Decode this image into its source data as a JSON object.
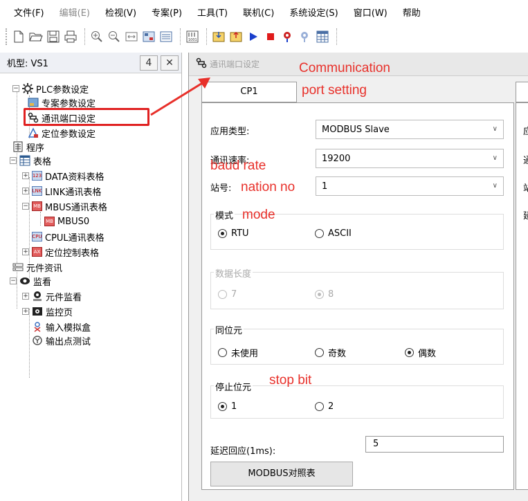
{
  "menu": {
    "items": [
      {
        "label": "文件(F)",
        "disabled": false
      },
      {
        "label": "编辑(E)",
        "disabled": true
      },
      {
        "label": "检视(V)",
        "disabled": false
      },
      {
        "label": "专案(P)",
        "disabled": false
      },
      {
        "label": "工具(T)",
        "disabled": false
      },
      {
        "label": "联机(C)",
        "disabled": false
      },
      {
        "label": "系统设定(S)",
        "disabled": false
      },
      {
        "label": "窗口(W)",
        "disabled": false
      },
      {
        "label": "帮助",
        "disabled": false
      }
    ]
  },
  "toolbar": {
    "icons": [
      "new-file-icon",
      "open-folder-icon",
      "save-icon",
      "print-icon",
      "zoom-in-icon",
      "zoom-out-icon",
      "fit-icon",
      "monitor-icon",
      "list-icon",
      "binary-icon",
      "download-icon",
      "upload-icon",
      "run-icon",
      "stop-icon",
      "monitor-on-icon",
      "monitor-off-icon",
      "table-icon"
    ],
    "colors": {
      "run": "#1a3fcc",
      "stop": "#e01b1b"
    }
  },
  "left_panel": {
    "title": "机型: VS1",
    "pin_label": "4",
    "close_label": "✕",
    "tree": {
      "plc_settings": "PLC参数设定",
      "project_params": "专案参数设定",
      "comm_port": "通讯端口设定",
      "position_params": "定位参数设定",
      "program": "程序",
      "tables": "表格",
      "data_table": "DATA资料表格",
      "link_table": "LINK通讯表格",
      "mbus_table": "MBUS通讯表格",
      "mbus0": "MBUS0",
      "cpul_table": "CPUL通讯表格",
      "position_table": "定位控制表格",
      "component_info": "元件资讯",
      "monitor": "监看",
      "component_monitor": "元件监看",
      "monitor_page": "监控页",
      "input_sim": "输入模拟盒",
      "output_test": "输出点测试"
    }
  },
  "dialog": {
    "title": "通讯端口设定",
    "tab1": "CP1",
    "app_type_label": "应用类型:",
    "app_type_value": "MODBUS Slave",
    "baud_label": "通讯速率:",
    "baud_value": "19200",
    "station_label": "站号:",
    "station_value": "1",
    "mode_group": "模式",
    "mode_rtu": "RTU",
    "mode_ascii": "ASCII",
    "data_length_group": "数据长度",
    "len7": "7",
    "len8": "8",
    "parity_group": "同位元",
    "parity_none": "未使用",
    "parity_odd": "奇数",
    "parity_even": "偶数",
    "stop_group": "停止位元",
    "stop1": "1",
    "stop2": "2",
    "delay_label": "延迟回应(1ms):",
    "delay_value": "5",
    "modbus_button": "MODBUS对照表",
    "pane2_glyphs": [
      "应",
      "通",
      "站",
      "延"
    ]
  },
  "annotations": {
    "comm_line1": "Communication",
    "comm_line2": "port setting",
    "baud": "baud rate",
    "station": "nation no",
    "mode": "mode",
    "stop": "stop bit",
    "color": "#e8302a"
  }
}
